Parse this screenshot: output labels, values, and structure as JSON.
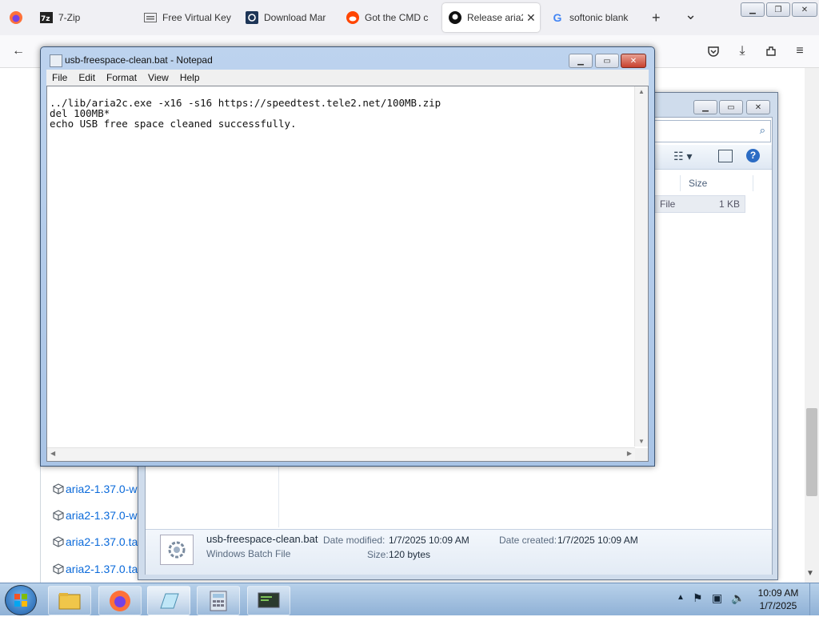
{
  "browser": {
    "tabs": [
      {
        "label": "7-Zip",
        "icon": "7zip-icon"
      },
      {
        "label": "Free Virtual Key",
        "icon": "keyboard-icon"
      },
      {
        "label": "Download Mar",
        "icon": "download-site-icon"
      },
      {
        "label": "Got the CMD c",
        "icon": "reddit-icon"
      },
      {
        "label": "Release aria2",
        "icon": "github-icon"
      },
      {
        "label": "softonic blank",
        "icon": "google-icon"
      }
    ],
    "new_tab": "+",
    "tab_list": "⌄"
  },
  "page": {
    "assets": [
      "aria2-1.37.0-w",
      "aria2-1.37.0-w",
      "aria2-1.37.0.ta",
      "aria2-1.37.0.ta"
    ]
  },
  "explorer": {
    "column_size": "Size",
    "row_type": "File",
    "row_size": "1 KB",
    "details": {
      "file_name": "usb-freespace-clean.bat",
      "file_type": "Windows Batch File",
      "date_modified_label": "Date modified:",
      "date_modified": "1/7/2025 10:09 AM",
      "date_created_label": "Date created:",
      "date_created": "1/7/2025 10:09 AM",
      "size_label": "Size:",
      "size": "120 bytes"
    }
  },
  "notepad": {
    "title": "usb-freespace-clean.bat - Notepad",
    "menu": [
      "File",
      "Edit",
      "Format",
      "View",
      "Help"
    ],
    "content": "../lib/aria2c.exe -x16 -s16 https://speedtest.tele2.net/100MB.zip\ndel 100MB*\necho USB free space cleaned successfully."
  },
  "taskbar": {
    "time": "10:09 AM",
    "date": "1/7/2025"
  },
  "colors": {
    "accent_link": "#0969da",
    "title_gradient": "#bdd3ee",
    "close_red": "#d9463a"
  }
}
